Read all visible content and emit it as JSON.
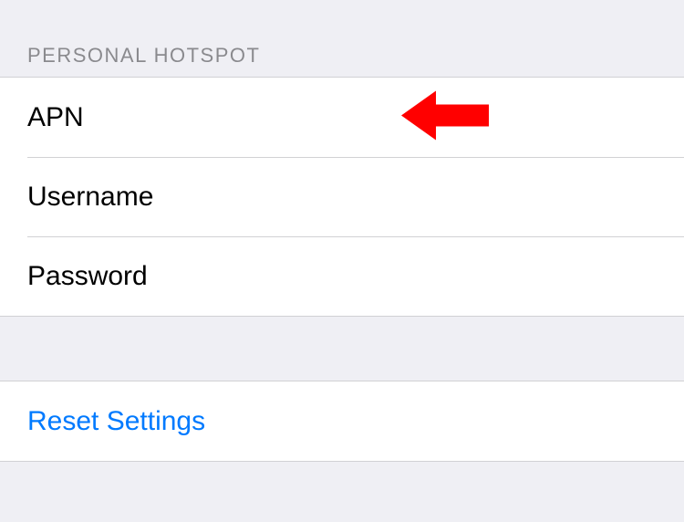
{
  "section": {
    "header": "PERSONAL HOTSPOT"
  },
  "fields": {
    "apn": {
      "label": "APN",
      "value": ""
    },
    "username": {
      "label": "Username",
      "value": ""
    },
    "password": {
      "label": "Password",
      "value": ""
    }
  },
  "reset": {
    "label": "Reset Settings"
  },
  "annotation": {
    "arrow_color": "#ff0000"
  }
}
